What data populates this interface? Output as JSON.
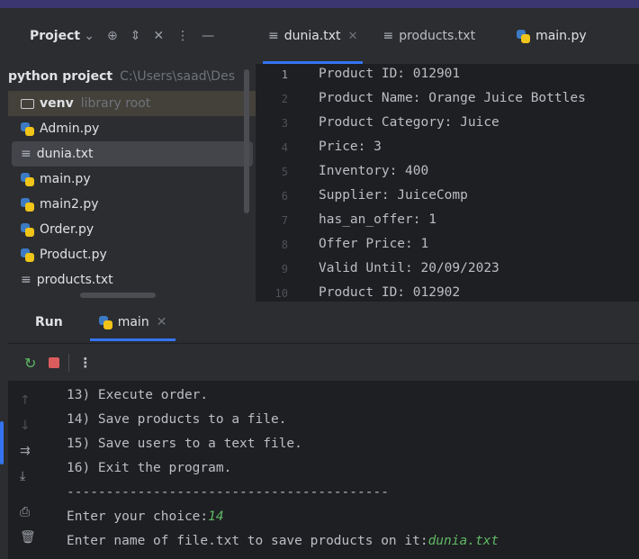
{
  "project": {
    "title": "Project",
    "root_name": "python project",
    "root_path": "C:\\Users\\saad\\Des",
    "venv": {
      "name": "venv",
      "hint": "library root"
    },
    "files": [
      {
        "name": "Admin.py",
        "icon": "python-file-icon"
      },
      {
        "name": "dunia.txt",
        "icon": "text-file-icon"
      },
      {
        "name": "main.py",
        "icon": "python-file-icon"
      },
      {
        "name": "main2.py",
        "icon": "python-file-icon"
      },
      {
        "name": "Order.py",
        "icon": "python-file-icon"
      },
      {
        "name": "Product.py",
        "icon": "python-file-icon"
      },
      {
        "name": "products.txt",
        "icon": "text-file-icon"
      }
    ]
  },
  "editor": {
    "tabs": [
      {
        "label": "dunia.txt",
        "active": true
      },
      {
        "label": "products.txt",
        "active": false
      },
      {
        "label": "main.py",
        "active": false
      }
    ],
    "line_numbers": [
      "1",
      "2",
      "3",
      "4",
      "5",
      "6",
      "7",
      "8",
      "9",
      "10"
    ],
    "lines": [
      "Product ID: 012901",
      "Product Name: Orange Juice Bottles",
      "Product Category: Juice",
      "Price: 3",
      "Inventory: 400",
      "Supplier: JuiceComp",
      "has_an_offer: 1",
      "Offer Price: 1",
      "Valid Until: 20/09/2023",
      "Product ID: 012902"
    ]
  },
  "run": {
    "label": "Run",
    "tab": "main",
    "console": {
      "menu": [
        "13) Execute order.",
        "14) Save products to a file.",
        "15) Save users to a text file.",
        "16) Exit the program."
      ],
      "separator": "-----------------------------------------",
      "prompt_choice": "Enter your choice:",
      "input_choice": "14",
      "prompt_file": "Enter name of file.txt to save products on it:",
      "input_file": "dunia.txt"
    }
  },
  "colors": {
    "accent": "#3574f0",
    "user_input": "#5fb865",
    "stop": "#db5c5c"
  }
}
